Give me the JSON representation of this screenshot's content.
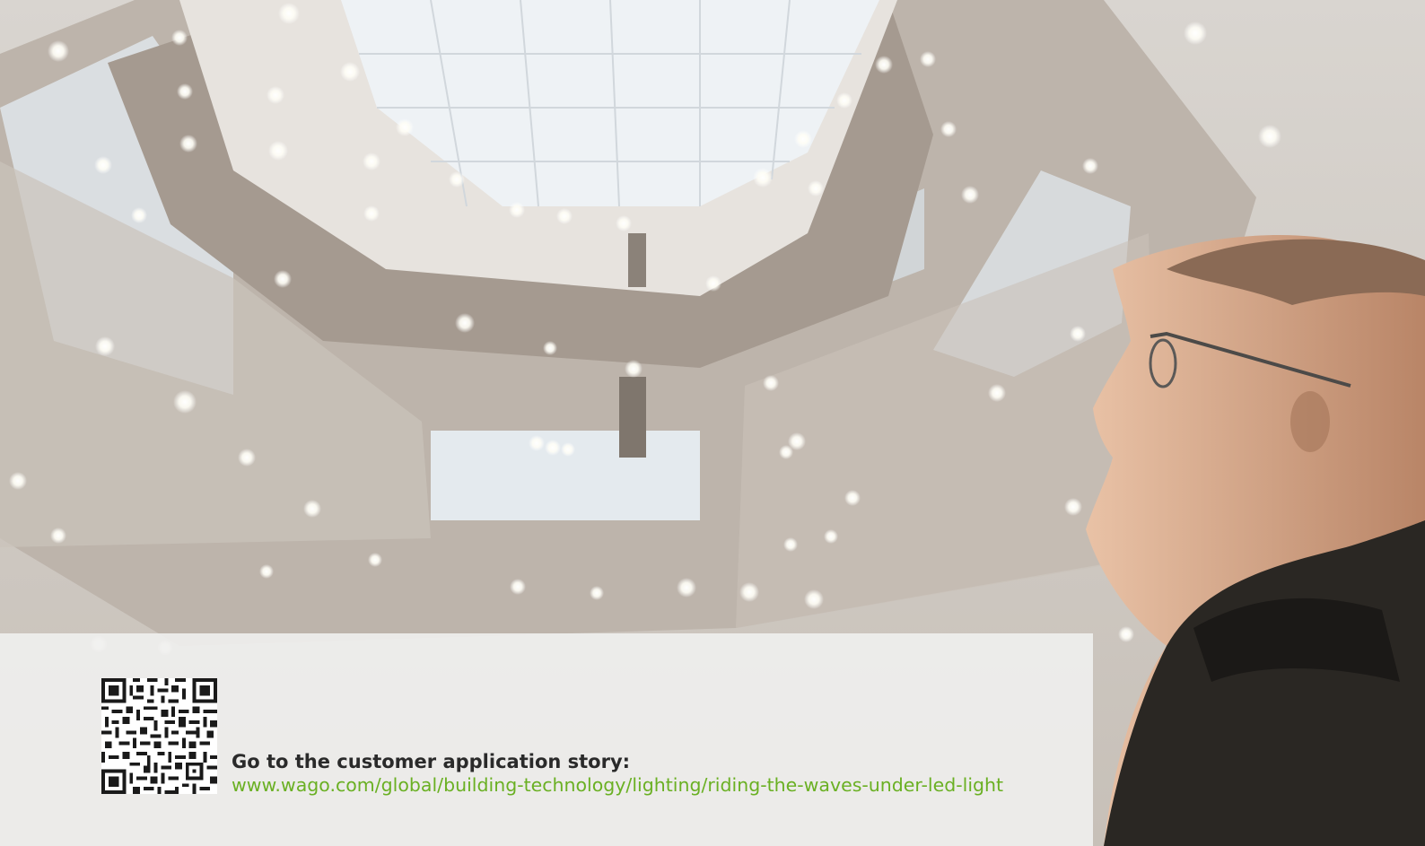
{
  "hero": {
    "alt": "Man in glasses looking up at an octagonal glass atrium ceiling with many round downlights"
  },
  "story": {
    "title": "Go to the customer application story:",
    "link": "www.wago.com/global/building-technology/lighting/riding-the-waves-under-led-light"
  },
  "colors": {
    "link": "#6ab023",
    "text": "#2a2a2a",
    "panel": "#f0f0ee"
  },
  "icons": {
    "qr": "qr-code-icon"
  }
}
